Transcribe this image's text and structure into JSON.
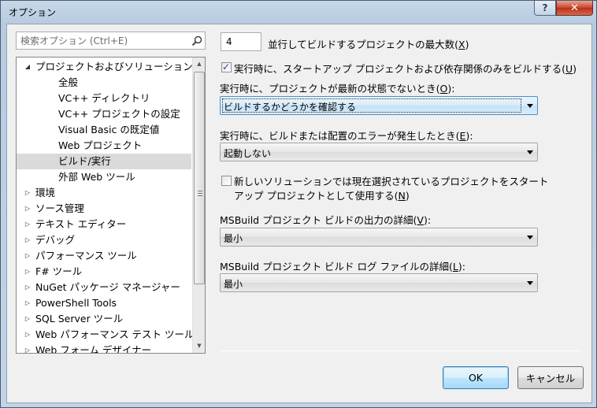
{
  "window": {
    "title": "オプション",
    "help_label": "?",
    "close_label": "✕"
  },
  "search": {
    "placeholder": "検索オプション (Ctrl+E)",
    "icon": "search-icon"
  },
  "tree": {
    "items": [
      {
        "label": "プロジェクトおよびソリューション",
        "level": 0,
        "arrow": "◢",
        "expanded": true
      },
      {
        "label": "全般",
        "level": 1,
        "arrow": ""
      },
      {
        "label": "VC++ ディレクトリ",
        "level": 1,
        "arrow": ""
      },
      {
        "label": "VC++ プロジェクトの設定",
        "level": 1,
        "arrow": ""
      },
      {
        "label": "Visual Basic の既定値",
        "level": 1,
        "arrow": ""
      },
      {
        "label": "Web プロジェクト",
        "level": 1,
        "arrow": ""
      },
      {
        "label": "ビルド/実行",
        "level": 1,
        "arrow": "",
        "selected": true
      },
      {
        "label": "外部 Web ツール",
        "level": 1,
        "arrow": ""
      },
      {
        "label": "環境",
        "level": 0,
        "arrow": "▷"
      },
      {
        "label": "ソース管理",
        "level": 0,
        "arrow": "▷"
      },
      {
        "label": "テキスト エディター",
        "level": 0,
        "arrow": "▷"
      },
      {
        "label": "デバッグ",
        "level": 0,
        "arrow": "▷"
      },
      {
        "label": "パフォーマンス ツール",
        "level": 0,
        "arrow": "▷"
      },
      {
        "label": "F# ツール",
        "level": 0,
        "arrow": "▷"
      },
      {
        "label": "NuGet パッケージ マネージャー",
        "level": 0,
        "arrow": "▷"
      },
      {
        "label": "PowerShell Tools",
        "level": 0,
        "arrow": "▷"
      },
      {
        "label": "SQL Server ツール",
        "level": 0,
        "arrow": "▷"
      },
      {
        "label": "Web パフォーマンス テスト ツール",
        "level": 0,
        "arrow": "▷"
      },
      {
        "label": "Web フォーム デザイナー",
        "level": 0,
        "arrow": "▷"
      }
    ]
  },
  "settings": {
    "max_parallel_value": "4",
    "max_parallel_label_pre": "並行してビルドするプロジェクトの最大数(",
    "max_parallel_key": "X",
    "max_parallel_label_post": ")",
    "only_startup_checked": true,
    "only_startup_pre": "実行時に、スタートアップ プロジェクトおよび依存関係のみをビルドする(",
    "only_startup_key": "U",
    "only_startup_post": ")",
    "outdated_label_pre": "実行時に、プロジェクトが最新の状態でないとき(",
    "outdated_key": "O",
    "outdated_label_post": "):",
    "outdated_value": "ビルドするかどうかを確認する",
    "error_label_pre": "実行時に、ビルドまたは配置のエラーが発生したとき(",
    "error_key": "E",
    "error_label_post": "):",
    "error_value": "起動しない",
    "new_solution_checked": false,
    "new_solution_line1": "新しいソリューションでは現在選択されているプロジェクトをスタート",
    "new_solution_line2_pre": "アップ プロジェクトとして使用する(",
    "new_solution_key": "N",
    "new_solution_line2_post": ")",
    "output_verbosity_pre": "MSBuild プロジェクト ビルドの出力の詳細(",
    "output_verbosity_key": "V",
    "output_verbosity_post": "):",
    "output_verbosity_value": "最小",
    "log_verbosity_pre": "MSBuild プロジェクト ビルド ログ ファイルの詳細(",
    "log_verbosity_key": "L",
    "log_verbosity_post": "):",
    "log_verbosity_value": "最小"
  },
  "buttons": {
    "ok": "OK",
    "cancel": "キャンセル"
  }
}
